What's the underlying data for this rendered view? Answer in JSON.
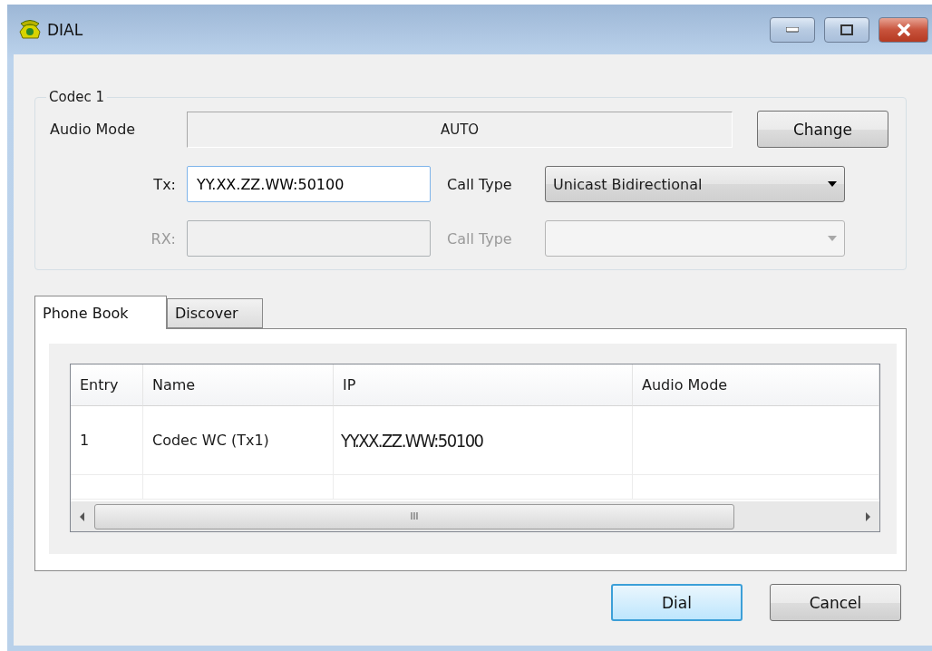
{
  "window": {
    "title": "DIAL"
  },
  "codec": {
    "legend": "Codec 1",
    "audio_mode_label": "Audio Mode",
    "audio_mode_value": "AUTO",
    "change_button": "Change",
    "tx": {
      "label": "Tx:",
      "value": "YY.XX.ZZ.WW:50100",
      "disabled": false
    },
    "tx_call_type": {
      "label": "Call Type",
      "value": "Unicast Bidirectional",
      "disabled": false
    },
    "rx": {
      "label": "RX:",
      "disabled": true
    },
    "rx_call_type": {
      "label": "Call Type",
      "disabled": true
    }
  },
  "tabs": [
    {
      "label": "Phone Book",
      "selected": true
    },
    {
      "label": "Discover",
      "selected": false
    }
  ],
  "table": {
    "columns": [
      "Entry",
      "Name",
      "IP",
      "Audio Mode"
    ],
    "rows": [
      {
        "entry": "1",
        "name": "Codec WC (Tx1)",
        "ip": "YY.XX.ZZ.WW:50100"
      }
    ]
  },
  "scrollbar_grip": "III",
  "buttons": [
    {
      "label": "Dial",
      "default": true
    },
    {
      "label": "Cancel",
      "default": false
    }
  ]
}
